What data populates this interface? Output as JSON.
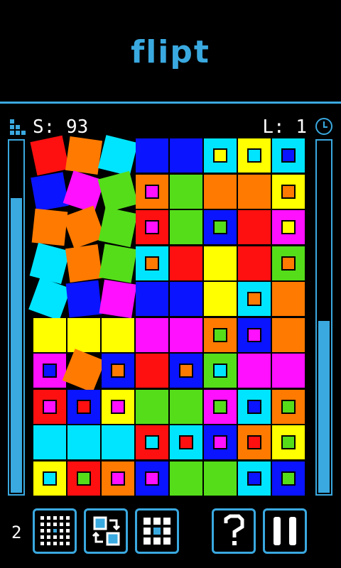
{
  "header": {
    "title": "flipt"
  },
  "status": {
    "score_text": "S: 93",
    "level_text": "L: 1"
  },
  "meters": {
    "left_level": 0.84,
    "right_level": 0.49
  },
  "footer": {
    "count_text": "2"
  },
  "colors": {
    "accent": "#3aa9e0",
    "red": "#ff1010",
    "orange": "#ff7a00",
    "cyan": "#00e5ff",
    "blue": "#0a14ff",
    "green": "#55dd1a",
    "yellow": "#ffff00",
    "magenta": "#ff10ff"
  },
  "board": {
    "rows": [
      [
        {
          "c": "red",
          "t": true
        },
        {
          "c": "orange",
          "t": true
        },
        {
          "c": "cyan",
          "t": true
        },
        {
          "c": "blue"
        },
        {
          "c": "blue"
        },
        {
          "c": "cyan",
          "i": "yellow"
        },
        {
          "c": "yellow",
          "i": "cyan"
        },
        {
          "c": "cyan",
          "i": "blue"
        }
      ],
      [
        {
          "c": "blue",
          "t": true
        },
        {
          "c": "magenta",
          "t": true
        },
        {
          "c": "green",
          "t": true
        },
        {
          "c": "orange",
          "i": "magenta"
        },
        {
          "c": "green"
        },
        {
          "c": "orange"
        },
        {
          "c": "orange"
        },
        {
          "c": "yellow",
          "i": "orange"
        }
      ],
      [
        {
          "c": "orange",
          "t": true
        },
        {
          "c": "orange",
          "t": true
        },
        {
          "c": "green",
          "t": true
        },
        {
          "c": "red",
          "i": "magenta"
        },
        {
          "c": "green"
        },
        {
          "c": "blue",
          "i": "green"
        },
        {
          "c": "red"
        },
        {
          "c": "magenta",
          "i": "yellow"
        }
      ],
      [
        {
          "c": "cyan",
          "t": true
        },
        {
          "c": "orange",
          "t": true
        },
        {
          "c": "green",
          "t": true
        },
        {
          "c": "cyan",
          "i": "orange"
        },
        {
          "c": "red"
        },
        {
          "c": "yellow"
        },
        {
          "c": "red"
        },
        {
          "c": "green",
          "i": "orange"
        }
      ],
      [
        {
          "c": "cyan",
          "t": true
        },
        {
          "c": "blue",
          "t": true
        },
        {
          "c": "magenta",
          "t": true
        },
        {
          "c": "blue"
        },
        {
          "c": "blue"
        },
        {
          "c": "yellow"
        },
        {
          "c": "cyan",
          "i": "orange"
        },
        {
          "c": "orange"
        }
      ],
      [
        {
          "c": "yellow"
        },
        {
          "c": "yellow"
        },
        {
          "c": "yellow"
        },
        {
          "c": "magenta"
        },
        {
          "c": "magenta"
        },
        {
          "c": "orange",
          "i": "green"
        },
        {
          "c": "blue",
          "i": "magenta"
        },
        {
          "c": "orange"
        }
      ],
      [
        {
          "c": "magenta",
          "i": "blue"
        },
        {
          "c": "orange",
          "t": true
        },
        {
          "c": "blue",
          "i": "orange"
        },
        {
          "c": "red"
        },
        {
          "c": "blue",
          "i": "orange"
        },
        {
          "c": "green",
          "i": "cyan"
        },
        {
          "c": "magenta"
        },
        {
          "c": "magenta"
        }
      ],
      [
        {
          "c": "red",
          "i": "magenta"
        },
        {
          "c": "blue",
          "i": "red"
        },
        {
          "c": "yellow",
          "i": "magenta"
        },
        {
          "c": "green"
        },
        {
          "c": "green"
        },
        {
          "c": "magenta",
          "i": "green"
        },
        {
          "c": "cyan",
          "i": "blue"
        },
        {
          "c": "orange",
          "i": "green"
        }
      ],
      [
        {
          "c": "cyan"
        },
        {
          "c": "cyan"
        },
        {
          "c": "cyan"
        },
        {
          "c": "red",
          "i": "cyan"
        },
        {
          "c": "cyan",
          "i": "red"
        },
        {
          "c": "blue",
          "i": "magenta"
        },
        {
          "c": "orange",
          "i": "red"
        },
        {
          "c": "yellow",
          "i": "green"
        }
      ],
      [
        {
          "c": "yellow",
          "i": "cyan"
        },
        {
          "c": "red",
          "i": "green"
        },
        {
          "c": "orange",
          "i": "magenta"
        },
        {
          "c": "blue",
          "i": "magenta"
        },
        {
          "c": "green"
        },
        {
          "c": "green"
        },
        {
          "c": "cyan",
          "i": "blue"
        },
        {
          "c": "blue",
          "i": "green"
        }
      ]
    ]
  },
  "buttons": [
    {
      "name": "dot-grid-button",
      "icon": "dot-grid-icon"
    },
    {
      "name": "swap-button",
      "icon": "swap-icon"
    },
    {
      "name": "grid-button",
      "icon": "grid-icon"
    },
    {
      "name": "help-button",
      "icon": "question-icon"
    },
    {
      "name": "pause-button",
      "icon": "pause-icon"
    }
  ]
}
